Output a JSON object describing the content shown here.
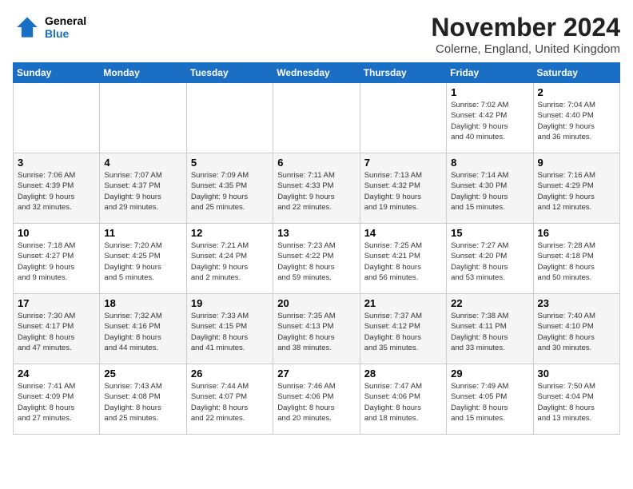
{
  "header": {
    "logo_line1": "General",
    "logo_line2": "Blue",
    "month": "November 2024",
    "location": "Colerne, England, United Kingdom"
  },
  "weekdays": [
    "Sunday",
    "Monday",
    "Tuesday",
    "Wednesday",
    "Thursday",
    "Friday",
    "Saturday"
  ],
  "weeks": [
    [
      {
        "day": "",
        "info": ""
      },
      {
        "day": "",
        "info": ""
      },
      {
        "day": "",
        "info": ""
      },
      {
        "day": "",
        "info": ""
      },
      {
        "day": "",
        "info": ""
      },
      {
        "day": "1",
        "info": "Sunrise: 7:02 AM\nSunset: 4:42 PM\nDaylight: 9 hours\nand 40 minutes."
      },
      {
        "day": "2",
        "info": "Sunrise: 7:04 AM\nSunset: 4:40 PM\nDaylight: 9 hours\nand 36 minutes."
      }
    ],
    [
      {
        "day": "3",
        "info": "Sunrise: 7:06 AM\nSunset: 4:39 PM\nDaylight: 9 hours\nand 32 minutes."
      },
      {
        "day": "4",
        "info": "Sunrise: 7:07 AM\nSunset: 4:37 PM\nDaylight: 9 hours\nand 29 minutes."
      },
      {
        "day": "5",
        "info": "Sunrise: 7:09 AM\nSunset: 4:35 PM\nDaylight: 9 hours\nand 25 minutes."
      },
      {
        "day": "6",
        "info": "Sunrise: 7:11 AM\nSunset: 4:33 PM\nDaylight: 9 hours\nand 22 minutes."
      },
      {
        "day": "7",
        "info": "Sunrise: 7:13 AM\nSunset: 4:32 PM\nDaylight: 9 hours\nand 19 minutes."
      },
      {
        "day": "8",
        "info": "Sunrise: 7:14 AM\nSunset: 4:30 PM\nDaylight: 9 hours\nand 15 minutes."
      },
      {
        "day": "9",
        "info": "Sunrise: 7:16 AM\nSunset: 4:29 PM\nDaylight: 9 hours\nand 12 minutes."
      }
    ],
    [
      {
        "day": "10",
        "info": "Sunrise: 7:18 AM\nSunset: 4:27 PM\nDaylight: 9 hours\nand 9 minutes."
      },
      {
        "day": "11",
        "info": "Sunrise: 7:20 AM\nSunset: 4:25 PM\nDaylight: 9 hours\nand 5 minutes."
      },
      {
        "day": "12",
        "info": "Sunrise: 7:21 AM\nSunset: 4:24 PM\nDaylight: 9 hours\nand 2 minutes."
      },
      {
        "day": "13",
        "info": "Sunrise: 7:23 AM\nSunset: 4:22 PM\nDaylight: 8 hours\nand 59 minutes."
      },
      {
        "day": "14",
        "info": "Sunrise: 7:25 AM\nSunset: 4:21 PM\nDaylight: 8 hours\nand 56 minutes."
      },
      {
        "day": "15",
        "info": "Sunrise: 7:27 AM\nSunset: 4:20 PM\nDaylight: 8 hours\nand 53 minutes."
      },
      {
        "day": "16",
        "info": "Sunrise: 7:28 AM\nSunset: 4:18 PM\nDaylight: 8 hours\nand 50 minutes."
      }
    ],
    [
      {
        "day": "17",
        "info": "Sunrise: 7:30 AM\nSunset: 4:17 PM\nDaylight: 8 hours\nand 47 minutes."
      },
      {
        "day": "18",
        "info": "Sunrise: 7:32 AM\nSunset: 4:16 PM\nDaylight: 8 hours\nand 44 minutes."
      },
      {
        "day": "19",
        "info": "Sunrise: 7:33 AM\nSunset: 4:15 PM\nDaylight: 8 hours\nand 41 minutes."
      },
      {
        "day": "20",
        "info": "Sunrise: 7:35 AM\nSunset: 4:13 PM\nDaylight: 8 hours\nand 38 minutes."
      },
      {
        "day": "21",
        "info": "Sunrise: 7:37 AM\nSunset: 4:12 PM\nDaylight: 8 hours\nand 35 minutes."
      },
      {
        "day": "22",
        "info": "Sunrise: 7:38 AM\nSunset: 4:11 PM\nDaylight: 8 hours\nand 33 minutes."
      },
      {
        "day": "23",
        "info": "Sunrise: 7:40 AM\nSunset: 4:10 PM\nDaylight: 8 hours\nand 30 minutes."
      }
    ],
    [
      {
        "day": "24",
        "info": "Sunrise: 7:41 AM\nSunset: 4:09 PM\nDaylight: 8 hours\nand 27 minutes."
      },
      {
        "day": "25",
        "info": "Sunrise: 7:43 AM\nSunset: 4:08 PM\nDaylight: 8 hours\nand 25 minutes."
      },
      {
        "day": "26",
        "info": "Sunrise: 7:44 AM\nSunset: 4:07 PM\nDaylight: 8 hours\nand 22 minutes."
      },
      {
        "day": "27",
        "info": "Sunrise: 7:46 AM\nSunset: 4:06 PM\nDaylight: 8 hours\nand 20 minutes."
      },
      {
        "day": "28",
        "info": "Sunrise: 7:47 AM\nSunset: 4:06 PM\nDaylight: 8 hours\nand 18 minutes."
      },
      {
        "day": "29",
        "info": "Sunrise: 7:49 AM\nSunset: 4:05 PM\nDaylight: 8 hours\nand 15 minutes."
      },
      {
        "day": "30",
        "info": "Sunrise: 7:50 AM\nSunset: 4:04 PM\nDaylight: 8 hours\nand 13 minutes."
      }
    ]
  ]
}
